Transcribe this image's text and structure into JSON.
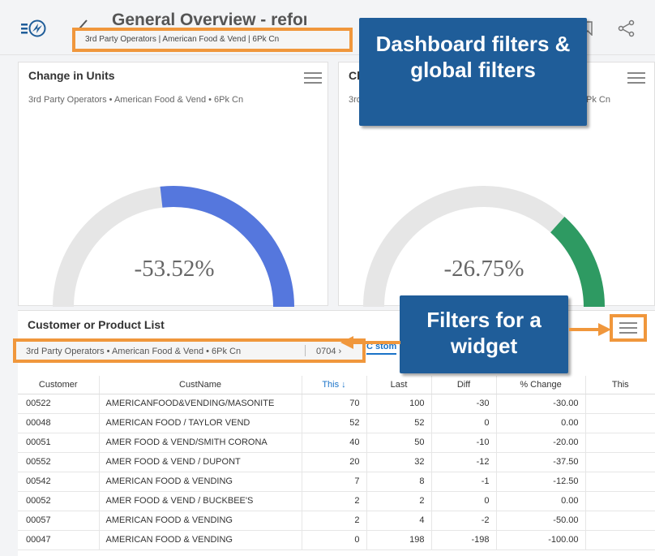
{
  "header": {
    "title": "General Overview - refor",
    "filters_text": "3rd Party Operators | American Food & Vend | 6Pk Cn"
  },
  "gauges": [
    {
      "title": "Change in Units",
      "subtitle": "3rd Party Operators • American Food & Vend • 6Pk Cn",
      "value_text": "-53.52%",
      "value": -53.52,
      "color": "#5577dd"
    },
    {
      "title": "Ch",
      "subtitle": "3rd",
      "subtitle_tail": "Pk Cn",
      "value_text": "-26.75%",
      "value": -26.75,
      "color": "#2e9a62"
    }
  ],
  "list": {
    "title": "Customer or Product List",
    "filters_text": "3rd Party Operators • American Food & Vend • 6Pk Cn",
    "filter_code": "0704 ›",
    "tab_label": "C stom",
    "columns": [
      "Customer",
      "CustName",
      "This ↓",
      "Last",
      "Diff",
      "% Change",
      "This"
    ],
    "rows": [
      [
        "00522",
        "AMERICANFOOD&VENDING/MASONITE",
        "70",
        "100",
        "-30",
        "-30.00"
      ],
      [
        "00048",
        "AMERICAN FOOD / TAYLOR VEND",
        "52",
        "52",
        "0",
        "0.00"
      ],
      [
        "00051",
        "AMER FOOD & VEND/SMITH CORONA",
        "40",
        "50",
        "-10",
        "-20.00"
      ],
      [
        "00552",
        "AMER FOOD & VEND / DUPONT",
        "20",
        "32",
        "-12",
        "-37.50"
      ],
      [
        "00542",
        "AMERICAN FOOD & VENDING",
        "7",
        "8",
        "-1",
        "-12.50"
      ],
      [
        "00052",
        "AMER FOOD & VEND / BUCKBEE'S",
        "2",
        "2",
        "0",
        "0.00"
      ],
      [
        "00057",
        "AMERICAN FOOD & VENDING",
        "2",
        "4",
        "-2",
        "-50.00"
      ],
      [
        "00047",
        "AMERICAN FOOD & VENDING",
        "0",
        "198",
        "-198",
        "-100.00"
      ]
    ]
  },
  "callouts": {
    "dashboard": "Dashboard filters & global filters",
    "widget": "Filters for a widget"
  },
  "colors": {
    "accent_orange": "#f0973c",
    "callout_blue": "#1f5d99",
    "link_blue": "#1a73c8"
  }
}
